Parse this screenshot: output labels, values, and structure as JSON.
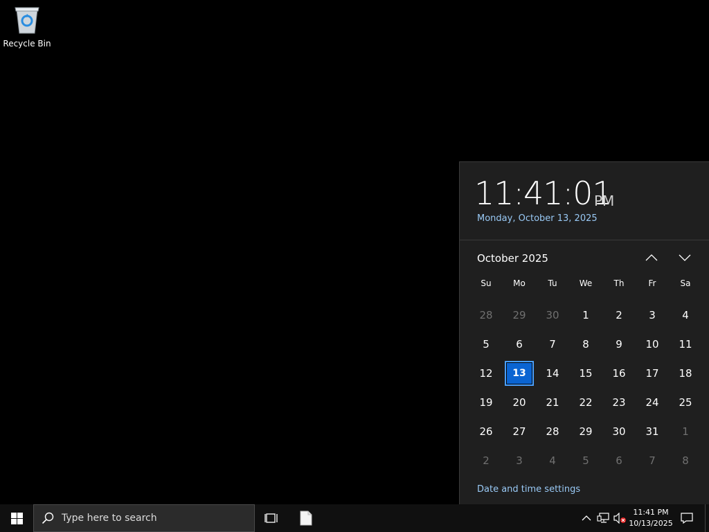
{
  "desktop": {
    "recycle_bin_label": "Recycle Bin"
  },
  "flyout": {
    "time": "11:41:01",
    "ampm": "PM",
    "long_date": "Monday, October 13, 2025",
    "month_label": "October 2025",
    "weekdays": [
      "Su",
      "Mo",
      "Tu",
      "We",
      "Th",
      "Fr",
      "Sa"
    ],
    "weeks": [
      [
        "28",
        "29",
        "30",
        "1",
        "2",
        "3",
        "4"
      ],
      [
        "5",
        "6",
        "7",
        "8",
        "9",
        "10",
        "11"
      ],
      [
        "12",
        "13",
        "14",
        "15",
        "16",
        "17",
        "18"
      ],
      [
        "19",
        "20",
        "21",
        "22",
        "23",
        "24",
        "25"
      ],
      [
        "26",
        "27",
        "28",
        "29",
        "30",
        "31",
        "1"
      ],
      [
        "2",
        "3",
        "4",
        "5",
        "6",
        "7",
        "8"
      ]
    ],
    "settings_link": "Date and time settings"
  },
  "taskbar": {
    "search_placeholder": "Type here to search",
    "clock_time": "11:41 PM",
    "clock_date": "10/13/2025"
  },
  "colors": {
    "accent": "#0a64d2",
    "link": "#99c9f5",
    "flyout_bg": "#1f1f1f"
  },
  "icons": [
    "recycle-bin-icon",
    "windows-logo-icon",
    "search-icon",
    "task-view-icon",
    "file-icon",
    "chevron-up-icon",
    "network-icon",
    "volume-muted-icon",
    "notification-icon"
  ]
}
